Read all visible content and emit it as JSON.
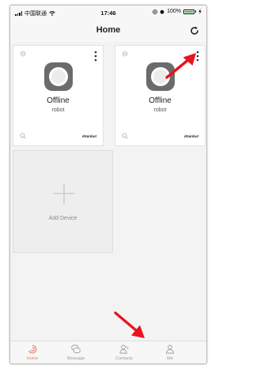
{
  "statusbar": {
    "carrier": "中国联通",
    "time": "17:46",
    "battery": "100%"
  },
  "header": {
    "title": "Home",
    "refresh_icon": "refresh-icon"
  },
  "devices": [
    {
      "status": "Offline",
      "name": "robot",
      "brand": "iRainbot"
    },
    {
      "status": "Offline",
      "name": "robot",
      "brand": "iRainbot"
    }
  ],
  "add_device": {
    "label": "Add Device"
  },
  "tabs": [
    {
      "label": "Home",
      "icon": "home-icon",
      "active": true
    },
    {
      "label": "Message",
      "icon": "message-icon",
      "active": false
    },
    {
      "label": "Contacts",
      "icon": "contacts-icon",
      "active": false
    },
    {
      "label": "Me",
      "icon": "person-icon",
      "active": false
    }
  ],
  "colors": {
    "accent": "#f08060",
    "annotation_arrow": "#e8141c",
    "background": "#f3f3f3"
  }
}
